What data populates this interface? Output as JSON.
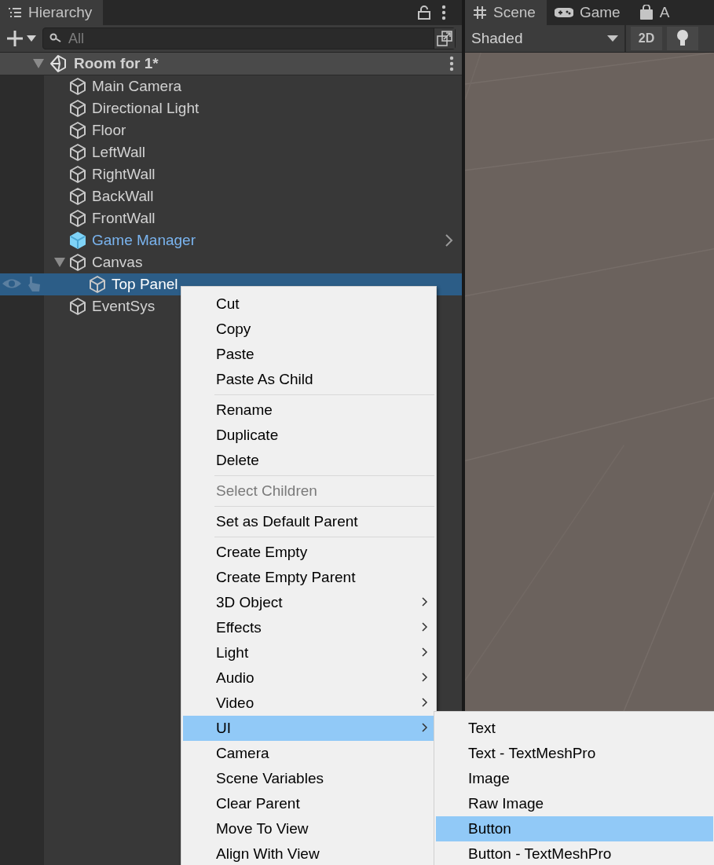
{
  "hierarchy": {
    "title": "Hierarchy",
    "search": {
      "placeholder": "All"
    },
    "scene": {
      "name": "Room for 1*",
      "expanded": true,
      "children": [
        {
          "name": "Main Camera",
          "kind": "object",
          "selected": false
        },
        {
          "name": "Directional Light",
          "kind": "object",
          "selected": false
        },
        {
          "name": "Floor",
          "kind": "object",
          "selected": false
        },
        {
          "name": "LeftWall",
          "kind": "object",
          "selected": false
        },
        {
          "name": "RightWall",
          "kind": "object",
          "selected": false
        },
        {
          "name": "BackWall",
          "kind": "object",
          "selected": false
        },
        {
          "name": "FrontWall",
          "kind": "object",
          "selected": false
        },
        {
          "name": "Game Manager",
          "kind": "prefab",
          "selected": false
        },
        {
          "name": "Canvas",
          "kind": "object",
          "selected": false,
          "expanded": true,
          "children": [
            {
              "name": "Top Panel",
              "kind": "object",
              "selected": true
            }
          ]
        },
        {
          "name": "EventSys",
          "kind": "object",
          "selected": false
        }
      ]
    }
  },
  "scene_view": {
    "tabs": [
      {
        "label": "Scene",
        "kind": "scene",
        "selected": true
      },
      {
        "label": "Game",
        "kind": "game",
        "selected": false
      },
      {
        "label": "A",
        "kind": "store",
        "selected": false
      }
    ],
    "shading": "Shaded",
    "mode_button": "2D"
  },
  "context_menu": {
    "sections": [
      [
        {
          "label": "Cut",
          "disabled": false,
          "submenu": false,
          "selected": false
        },
        {
          "label": "Copy",
          "disabled": false,
          "submenu": false,
          "selected": false
        },
        {
          "label": "Paste",
          "disabled": false,
          "submenu": false,
          "selected": false
        },
        {
          "label": "Paste As Child",
          "disabled": false,
          "submenu": false,
          "selected": false
        }
      ],
      [
        {
          "label": "Rename",
          "disabled": false,
          "submenu": false,
          "selected": false
        },
        {
          "label": "Duplicate",
          "disabled": false,
          "submenu": false,
          "selected": false
        },
        {
          "label": "Delete",
          "disabled": false,
          "submenu": false,
          "selected": false
        }
      ],
      [
        {
          "label": "Select Children",
          "disabled": true,
          "submenu": false,
          "selected": false
        }
      ],
      [
        {
          "label": "Set as Default Parent",
          "disabled": false,
          "submenu": false,
          "selected": false
        }
      ],
      [
        {
          "label": "Create Empty",
          "disabled": false,
          "submenu": false,
          "selected": false
        },
        {
          "label": "Create Empty Parent",
          "disabled": false,
          "submenu": false,
          "selected": false
        },
        {
          "label": "3D Object",
          "disabled": false,
          "submenu": true,
          "selected": false
        },
        {
          "label": "Effects",
          "disabled": false,
          "submenu": true,
          "selected": false
        },
        {
          "label": "Light",
          "disabled": false,
          "submenu": true,
          "selected": false
        },
        {
          "label": "Audio",
          "disabled": false,
          "submenu": true,
          "selected": false
        },
        {
          "label": "Video",
          "disabled": false,
          "submenu": true,
          "selected": false
        },
        {
          "label": "UI",
          "disabled": false,
          "submenu": true,
          "selected": true
        },
        {
          "label": "Camera",
          "disabled": false,
          "submenu": false,
          "selected": false
        },
        {
          "label": "Scene Variables",
          "disabled": false,
          "submenu": false,
          "selected": false
        },
        {
          "label": "Clear Parent",
          "disabled": false,
          "submenu": false,
          "selected": false
        },
        {
          "label": "Move To View",
          "disabled": false,
          "submenu": false,
          "selected": false
        },
        {
          "label": "Align With View",
          "disabled": false,
          "submenu": false,
          "selected": false
        }
      ]
    ]
  },
  "submenu": {
    "items": [
      {
        "label": "Text",
        "selected": false
      },
      {
        "label": "Text - TextMeshPro",
        "selected": false
      },
      {
        "label": "Image",
        "selected": false
      },
      {
        "label": "Raw Image",
        "selected": false
      },
      {
        "label": "Button",
        "selected": true
      },
      {
        "label": "Button - TextMeshPro",
        "selected": false
      }
    ]
  }
}
